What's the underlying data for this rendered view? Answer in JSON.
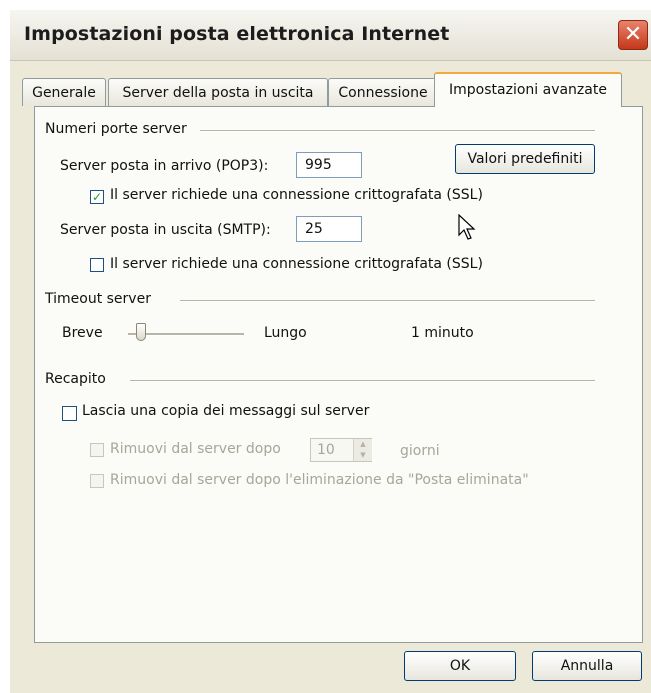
{
  "window": {
    "title": "Impostazioni posta elettronica Internet",
    "close_label": "✕"
  },
  "tabs": [
    {
      "label": "Generale"
    },
    {
      "label": "Server della posta in uscita"
    },
    {
      "label": "Connessione"
    },
    {
      "label": "Impostazioni avanzate"
    }
  ],
  "ports": {
    "group_label": "Numeri porte server",
    "incoming_label": "Server posta in arrivo (POP3):",
    "incoming_value": "995",
    "defaults_button": "Valori predefiniti",
    "incoming_ssl_label": "Il server richiede una connessione crittografata (SSL)",
    "incoming_ssl_checked": true,
    "outgoing_label": "Server posta in uscita (SMTP):",
    "outgoing_value": "25",
    "outgoing_ssl_label": "Il server richiede una connessione crittografata (SSL)",
    "outgoing_ssl_checked": false
  },
  "timeout": {
    "group_label": "Timeout server",
    "short_label": "Breve",
    "long_label": "Lungo",
    "value_text": "1 minuto",
    "slider_fraction": 0.0
  },
  "delivery": {
    "group_label": "Recapito",
    "leave_copy_label": "Lascia una copia dei messaggi sul server",
    "leave_copy_checked": false,
    "remove_after_label": "Rimuovi dal server dopo",
    "remove_after_value": "10",
    "days_label": "giorni",
    "remove_deleted_label": "Rimuovi dal server dopo l'eliminazione da \"Posta eliminata\""
  },
  "footer": {
    "ok_label": "OK",
    "cancel_label": "Annulla"
  },
  "colors": {
    "dialog_bg": "#ece9d8",
    "panel_bg": "#fbfbf8",
    "close_red": "#c5371a",
    "check_green": "#21a121",
    "active_tab_accent": "#f4a640"
  }
}
